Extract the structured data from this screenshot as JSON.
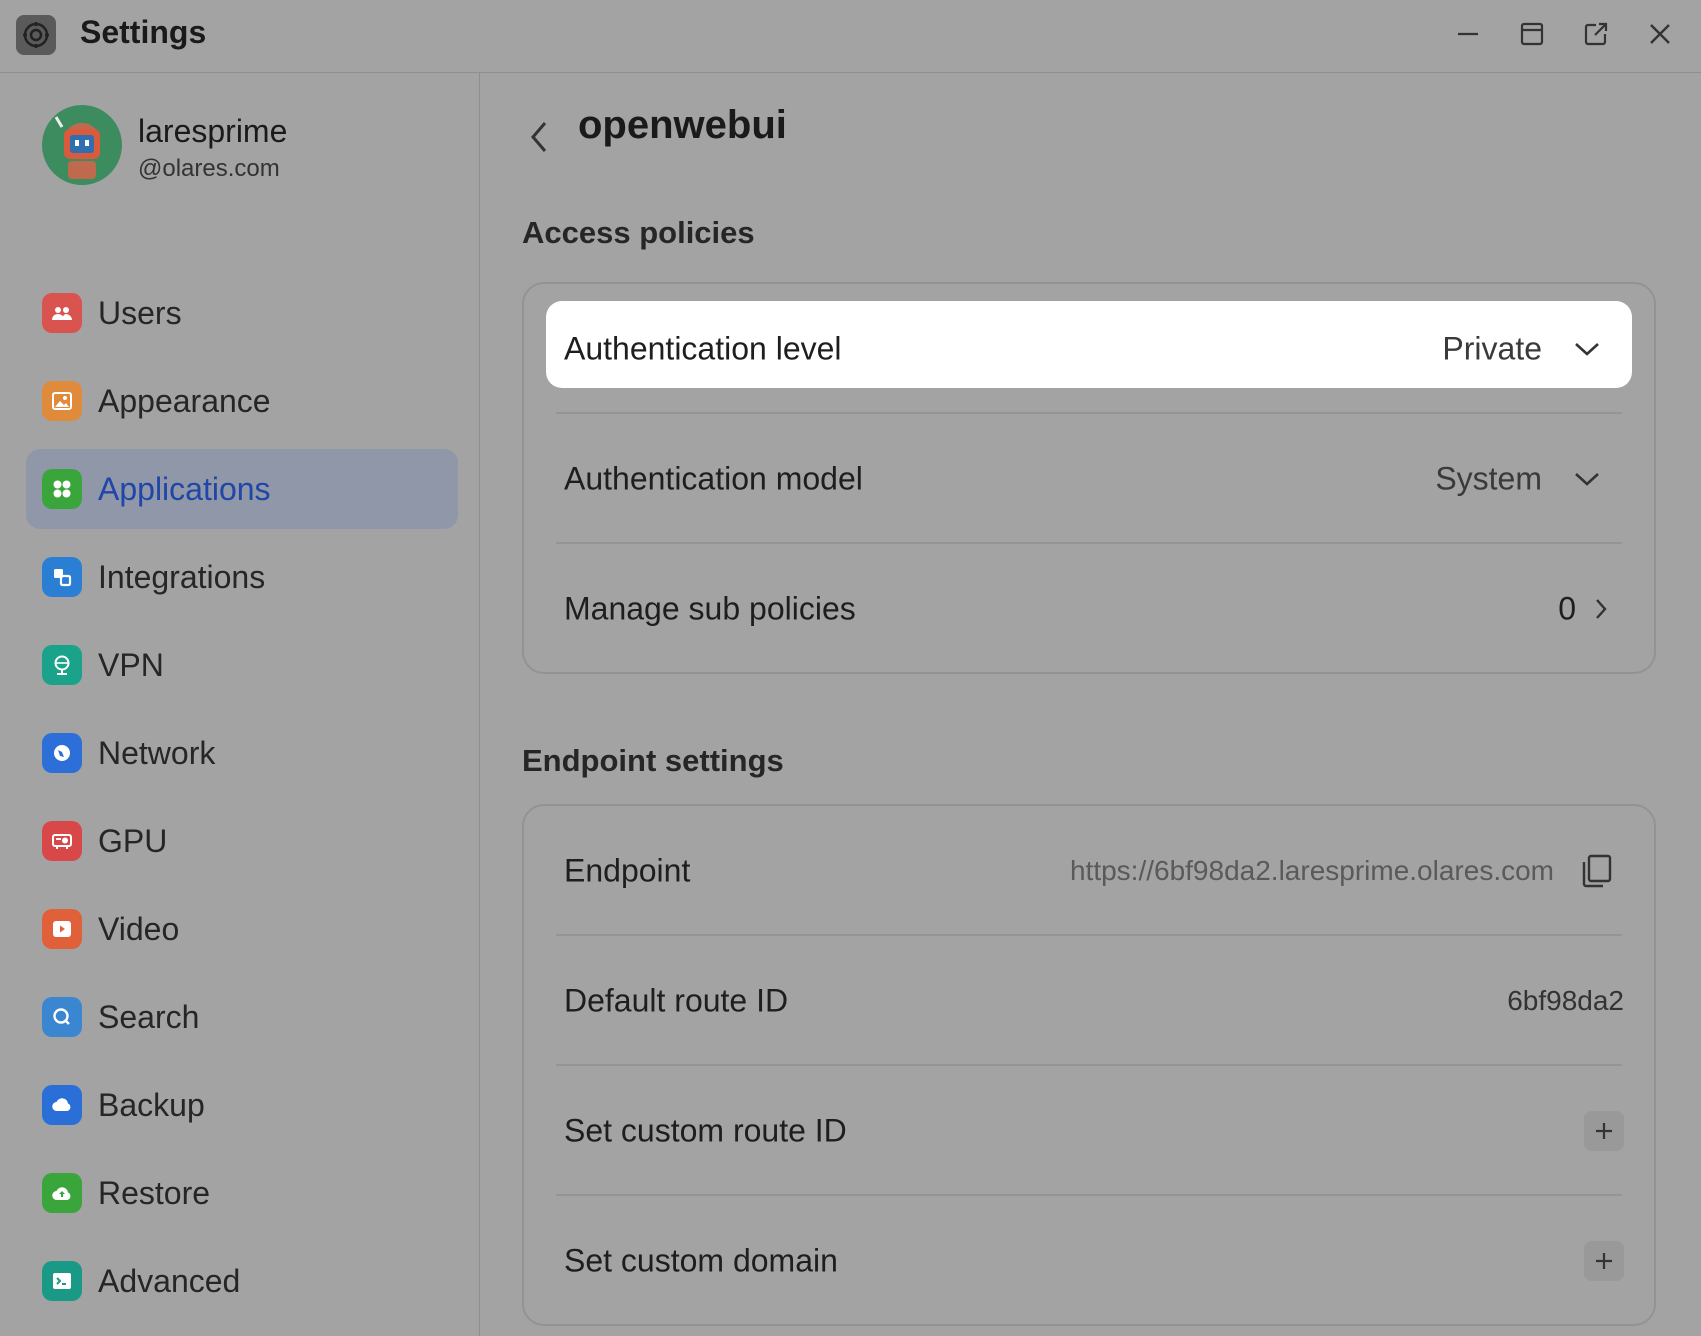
{
  "window": {
    "title": "Settings",
    "controls": [
      "minimize-icon",
      "maximize-icon",
      "pop-out-icon",
      "close-icon"
    ]
  },
  "profile": {
    "name": "laresprime",
    "domain": "@olares.com"
  },
  "sidebar": {
    "items": [
      {
        "label": "Users",
        "icon": "users-icon",
        "color": "#d9534f"
      },
      {
        "label": "Appearance",
        "icon": "image-icon",
        "color": "#e08a3c"
      },
      {
        "label": "Applications",
        "icon": "apps-icon",
        "color": "#3aa53a",
        "active": true
      },
      {
        "label": "Integrations",
        "icon": "integrations-icon",
        "color": "#2a7fd4"
      },
      {
        "label": "VPN",
        "icon": "vpn-icon",
        "color": "#1aa38a"
      },
      {
        "label": "Network",
        "icon": "network-icon",
        "color": "#2d6fd8"
      },
      {
        "label": "GPU",
        "icon": "gpu-icon",
        "color": "#d94848"
      },
      {
        "label": "Video",
        "icon": "video-icon",
        "color": "#e0603a"
      },
      {
        "label": "Search",
        "icon": "search-icon",
        "color": "#3a86d0"
      },
      {
        "label": "Backup",
        "icon": "cloud-icon",
        "color": "#2a6fd8"
      },
      {
        "label": "Restore",
        "icon": "restore-icon",
        "color": "#3aa53a"
      },
      {
        "label": "Advanced",
        "icon": "terminal-icon",
        "color": "#1a9a86"
      }
    ]
  },
  "main": {
    "title": "openwebui",
    "access_policies": {
      "heading": "Access policies",
      "authentication_level": {
        "label": "Authentication level",
        "value": "Private"
      },
      "authentication_model": {
        "label": "Authentication model",
        "value": "System"
      },
      "sub_policies": {
        "label": "Manage sub policies",
        "value": "0"
      }
    },
    "endpoint_settings": {
      "heading": "Endpoint settings",
      "endpoint": {
        "label": "Endpoint",
        "value": "https://6bf98da2.laresprime.olares.com"
      },
      "default_route": {
        "label": "Default route ID",
        "value": "6bf98da2"
      },
      "custom_route": {
        "label": "Set custom route ID"
      },
      "custom_domain": {
        "label": "Set custom domain"
      }
    }
  }
}
